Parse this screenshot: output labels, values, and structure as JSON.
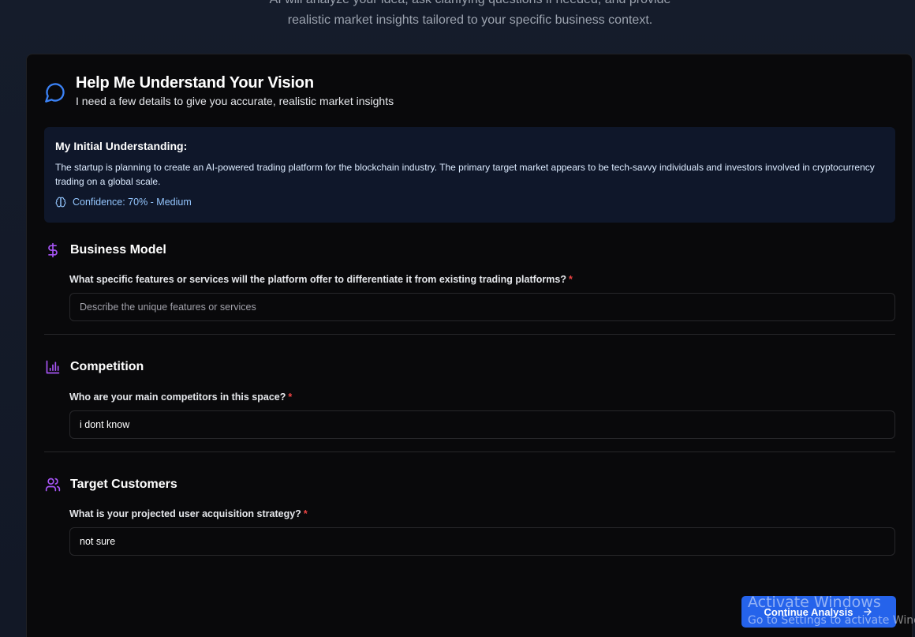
{
  "intro": {
    "line1": "AI will analyze your idea, ask clarifying questions if needed, and provide",
    "line2": "realistic market insights tailored to your specific business context."
  },
  "header": {
    "icon": "chat-bubble-icon",
    "title": "Help Me Understand Your Vision",
    "subtitle": "I need a few details to give you accurate, realistic market insights"
  },
  "understanding": {
    "title": "My Initial Understanding:",
    "description": "The startup is planning to create an AI-powered trading platform for the blockchain industry. The primary target market appears to be tech-savvy individuals and investors involved in cryptocurrency trading on a global scale.",
    "confidence": "Confidence: 70% - Medium",
    "icon": "brain-icon"
  },
  "sections": [
    {
      "icon": "dollar-icon",
      "title": "Business Model",
      "question": "What specific features or services will the platform offer to differentiate it from existing trading platforms?",
      "required_mark": "*",
      "value": "",
      "placeholder": "Describe the unique features or services"
    },
    {
      "icon": "bar-chart-icon",
      "title": "Competition",
      "question": "Who are your main competitors in this space?",
      "required_mark": "*",
      "value": "i dont know",
      "placeholder": ""
    },
    {
      "icon": "users-icon",
      "title": "Target Customers",
      "question": "What is your projected user acquisition strategy?",
      "required_mark": "*",
      "value": "not sure",
      "placeholder": ""
    }
  ],
  "continue_button": {
    "label": "Continue Analysis",
    "icon": "arrow-right-icon"
  },
  "watermark": {
    "line1": "Activate Windows",
    "line2": "Go to Settings to activate Windows."
  },
  "colors": {
    "accent_blue": "#2563eb",
    "icon_purple": "#a855f7",
    "chat_icon_blue": "#3b82f6",
    "required_red": "#ef4444",
    "info_box_bg": "#0f172a"
  }
}
